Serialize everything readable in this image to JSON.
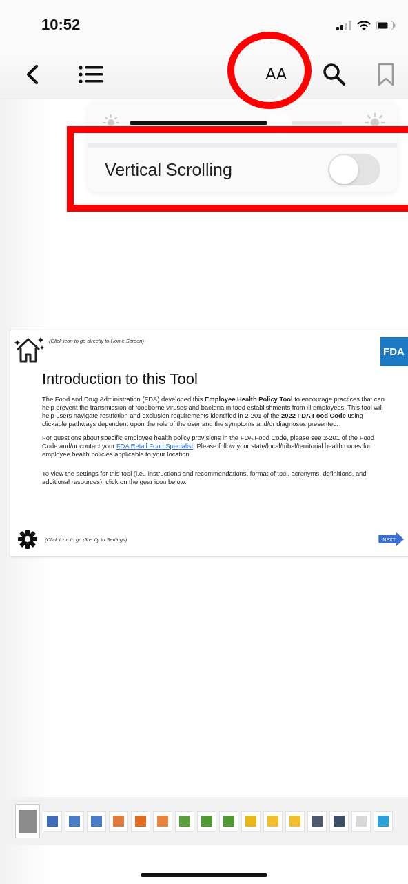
{
  "status_bar": {
    "time": "10:52"
  },
  "toolbar": {
    "font_button": {
      "label": "AA",
      "selected": true
    }
  },
  "popover": {
    "brightness": {
      "level": 0.65
    },
    "options": [
      {
        "label": "Vertical Scrolling",
        "on": false
      }
    ]
  },
  "slide": {
    "home_hint": "(Click icon to go directly to Home Screen)",
    "logo": "FDA",
    "title": "Introduction to this Tool",
    "paragraphs": [
      {
        "text": "The Food and Drug Administration (FDA) developed this **Employee Health Policy Tool** to encourage practices that can help prevent the transmission of foodborne viruses and bacteria in food establishments from ill employees. This tool will help users navigate restriction and exclusion requirements identified in 2-201 of the **2022 FDA Food Code** using clickable pathways dependent upon the role of the user and the symptoms and/or diagnoses presented."
      },
      {
        "text": "For questions about specific employee health policy provisions in the FDA Food Code, please see 2-201 of the Food Code and/or contact your",
        "link": "FDA Retail Food Specialist",
        "after": ".  Please follow your state/local/tribal/territorial health codes for employee health policies applicable to your location."
      },
      {
        "text": "To view the settings for this tool (i.e., instructions and recommendations, format of tool, acronyms, definitions, and additional resources), click on the gear icon below."
      }
    ],
    "settings_hint": "(Click icon to go directly to Settings)",
    "next": "NEXT"
  },
  "thumbnails": [
    {
      "selected": true,
      "color": "#8c8c8c"
    },
    {
      "selected": false,
      "color": "#3f6db5"
    },
    {
      "selected": false,
      "color": "#4a7cc4"
    },
    {
      "selected": false,
      "color": "#4a7cc4"
    },
    {
      "selected": false,
      "color": "#e07a3a"
    },
    {
      "selected": false,
      "color": "#e06a20"
    },
    {
      "selected": false,
      "color": "#e8843e"
    },
    {
      "selected": false,
      "color": "#5a9e3c"
    },
    {
      "selected": false,
      "color": "#4f9a2f"
    },
    {
      "selected": false,
      "color": "#4f9a2f"
    },
    {
      "selected": false,
      "color": "#e8b818"
    },
    {
      "selected": false,
      "color": "#f0be30"
    },
    {
      "selected": false,
      "color": "#f0be30"
    },
    {
      "selected": false,
      "color": "#4a5870"
    },
    {
      "selected": false,
      "color": "#3f4e68"
    },
    {
      "selected": false,
      "color": "#d8d8d8"
    },
    {
      "selected": false,
      "color": "#2aa0d8"
    }
  ],
  "annotations": [
    {
      "kind": "ellipse"
    },
    {
      "kind": "rectangle"
    }
  ]
}
